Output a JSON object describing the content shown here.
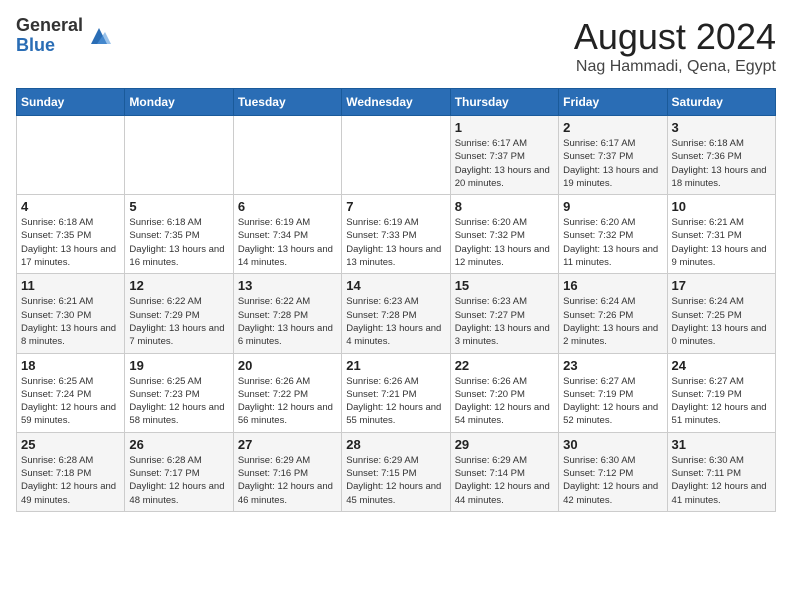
{
  "logo": {
    "general": "General",
    "blue": "Blue"
  },
  "title": "August 2024",
  "location": "Nag Hammadi, Qena, Egypt",
  "days_of_week": [
    "Sunday",
    "Monday",
    "Tuesday",
    "Wednesday",
    "Thursday",
    "Friday",
    "Saturday"
  ],
  "weeks": [
    [
      {
        "num": "",
        "info": ""
      },
      {
        "num": "",
        "info": ""
      },
      {
        "num": "",
        "info": ""
      },
      {
        "num": "",
        "info": ""
      },
      {
        "num": "1",
        "info": "Sunrise: 6:17 AM\nSunset: 7:37 PM\nDaylight: 13 hours\nand 20 minutes."
      },
      {
        "num": "2",
        "info": "Sunrise: 6:17 AM\nSunset: 7:37 PM\nDaylight: 13 hours\nand 19 minutes."
      },
      {
        "num": "3",
        "info": "Sunrise: 6:18 AM\nSunset: 7:36 PM\nDaylight: 13 hours\nand 18 minutes."
      }
    ],
    [
      {
        "num": "4",
        "info": "Sunrise: 6:18 AM\nSunset: 7:35 PM\nDaylight: 13 hours\nand 17 minutes."
      },
      {
        "num": "5",
        "info": "Sunrise: 6:18 AM\nSunset: 7:35 PM\nDaylight: 13 hours\nand 16 minutes."
      },
      {
        "num": "6",
        "info": "Sunrise: 6:19 AM\nSunset: 7:34 PM\nDaylight: 13 hours\nand 14 minutes."
      },
      {
        "num": "7",
        "info": "Sunrise: 6:19 AM\nSunset: 7:33 PM\nDaylight: 13 hours\nand 13 minutes."
      },
      {
        "num": "8",
        "info": "Sunrise: 6:20 AM\nSunset: 7:32 PM\nDaylight: 13 hours\nand 12 minutes."
      },
      {
        "num": "9",
        "info": "Sunrise: 6:20 AM\nSunset: 7:32 PM\nDaylight: 13 hours\nand 11 minutes."
      },
      {
        "num": "10",
        "info": "Sunrise: 6:21 AM\nSunset: 7:31 PM\nDaylight: 13 hours\nand 9 minutes."
      }
    ],
    [
      {
        "num": "11",
        "info": "Sunrise: 6:21 AM\nSunset: 7:30 PM\nDaylight: 13 hours\nand 8 minutes."
      },
      {
        "num": "12",
        "info": "Sunrise: 6:22 AM\nSunset: 7:29 PM\nDaylight: 13 hours\nand 7 minutes."
      },
      {
        "num": "13",
        "info": "Sunrise: 6:22 AM\nSunset: 7:28 PM\nDaylight: 13 hours\nand 6 minutes."
      },
      {
        "num": "14",
        "info": "Sunrise: 6:23 AM\nSunset: 7:28 PM\nDaylight: 13 hours\nand 4 minutes."
      },
      {
        "num": "15",
        "info": "Sunrise: 6:23 AM\nSunset: 7:27 PM\nDaylight: 13 hours\nand 3 minutes."
      },
      {
        "num": "16",
        "info": "Sunrise: 6:24 AM\nSunset: 7:26 PM\nDaylight: 13 hours\nand 2 minutes."
      },
      {
        "num": "17",
        "info": "Sunrise: 6:24 AM\nSunset: 7:25 PM\nDaylight: 13 hours\nand 0 minutes."
      }
    ],
    [
      {
        "num": "18",
        "info": "Sunrise: 6:25 AM\nSunset: 7:24 PM\nDaylight: 12 hours\nand 59 minutes."
      },
      {
        "num": "19",
        "info": "Sunrise: 6:25 AM\nSunset: 7:23 PM\nDaylight: 12 hours\nand 58 minutes."
      },
      {
        "num": "20",
        "info": "Sunrise: 6:26 AM\nSunset: 7:22 PM\nDaylight: 12 hours\nand 56 minutes."
      },
      {
        "num": "21",
        "info": "Sunrise: 6:26 AM\nSunset: 7:21 PM\nDaylight: 12 hours\nand 55 minutes."
      },
      {
        "num": "22",
        "info": "Sunrise: 6:26 AM\nSunset: 7:20 PM\nDaylight: 12 hours\nand 54 minutes."
      },
      {
        "num": "23",
        "info": "Sunrise: 6:27 AM\nSunset: 7:19 PM\nDaylight: 12 hours\nand 52 minutes."
      },
      {
        "num": "24",
        "info": "Sunrise: 6:27 AM\nSunset: 7:19 PM\nDaylight: 12 hours\nand 51 minutes."
      }
    ],
    [
      {
        "num": "25",
        "info": "Sunrise: 6:28 AM\nSunset: 7:18 PM\nDaylight: 12 hours\nand 49 minutes."
      },
      {
        "num": "26",
        "info": "Sunrise: 6:28 AM\nSunset: 7:17 PM\nDaylight: 12 hours\nand 48 minutes."
      },
      {
        "num": "27",
        "info": "Sunrise: 6:29 AM\nSunset: 7:16 PM\nDaylight: 12 hours\nand 46 minutes."
      },
      {
        "num": "28",
        "info": "Sunrise: 6:29 AM\nSunset: 7:15 PM\nDaylight: 12 hours\nand 45 minutes."
      },
      {
        "num": "29",
        "info": "Sunrise: 6:29 AM\nSunset: 7:14 PM\nDaylight: 12 hours\nand 44 minutes."
      },
      {
        "num": "30",
        "info": "Sunrise: 6:30 AM\nSunset: 7:12 PM\nDaylight: 12 hours\nand 42 minutes."
      },
      {
        "num": "31",
        "info": "Sunrise: 6:30 AM\nSunset: 7:11 PM\nDaylight: 12 hours\nand 41 minutes."
      }
    ]
  ]
}
